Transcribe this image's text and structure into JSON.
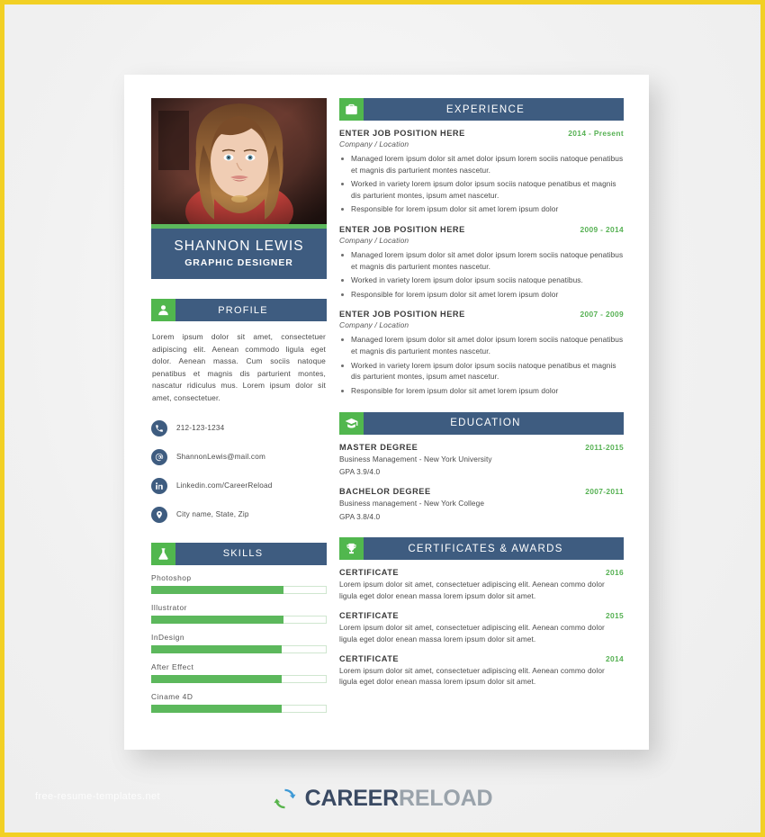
{
  "document": {
    "type": "resume-template-preview"
  },
  "watermark": {
    "text": "free-resume-templates.net"
  },
  "colors": {
    "navy": "#3e5c80",
    "green": "#5cb85c",
    "accent_green_text": "#56b153",
    "border_gold": "#f2d024",
    "body_text": "#4a4a4a"
  },
  "resume": {
    "photo": {
      "alt": "portrait-photo"
    },
    "nameplate": {
      "name": "SHANNON LEWIS",
      "role": "GRAPHIC DESIGNER"
    },
    "profile": {
      "icon": "user-icon",
      "title": "PROFILE",
      "text": "Lorem ipsum dolor sit amet, consectetuer adipiscing elit. Aenean commodo ligula eget dolor. Aenean massa. Cum sociis natoque penatibus et magnis dis parturient montes, nascatur ridiculus mus. Lorem ipsum dolor sit amet, consectetuer."
    },
    "contacts": [
      {
        "icon": "phone-icon",
        "value": "212-123-1234"
      },
      {
        "icon": "email-icon",
        "value": "ShannonLewis@mail.com"
      },
      {
        "icon": "linkedin-icon",
        "value": "Linkedin.com/CareerReload"
      },
      {
        "icon": "location-icon",
        "value": "City name, State, Zip"
      }
    ],
    "skills": {
      "icon": "flask-icon",
      "title": "SKILLS",
      "items": [
        {
          "name": "Photoshop",
          "percent": 75
        },
        {
          "name": "Illustrator",
          "percent": 75
        },
        {
          "name": "InDesign",
          "percent": 74
        },
        {
          "name": "After Effect",
          "percent": 74
        },
        {
          "name": "Ciname 4D",
          "percent": 74
        }
      ]
    },
    "experience": {
      "icon": "briefcase-icon",
      "title": "EXPERIENCE",
      "entries": [
        {
          "position": "ENTER JOB POSITION HERE",
          "date": "2014 - Present",
          "company": "Company / Location",
          "bullets": [
            "Managed lorem ipsum dolor sit amet dolor ipsum lorem sociis natoque penatibus et magnis dis parturient montes nascetur.",
            "Worked in variety lorem ipsum dolor ipsum sociis natoque penatibus et magnis dis parturient montes, ipsum amet nascetur.",
            "Responsible for lorem ipsum dolor sit amet lorem ipsum dolor"
          ]
        },
        {
          "position": "ENTER JOB POSITION HERE",
          "date": "2009 - 2014",
          "company": "Company / Location",
          "bullets": [
            "Managed lorem ipsum dolor sit amet dolor ipsum lorem sociis natoque penatibus et magnis dis parturient montes nascetur.",
            "Worked in variety lorem ipsum dolor ipsum sociis natoque penatibus.",
            "Responsible for lorem ipsum dolor sit amet lorem ipsum dolor"
          ]
        },
        {
          "position": "ENTER JOB POSITION HERE",
          "date": "2007 - 2009",
          "company": "Company / Location",
          "bullets": [
            "Managed lorem ipsum dolor sit amet dolor ipsum lorem sociis natoque penatibus et magnis dis parturient montes nascetur.",
            "Worked in variety lorem ipsum dolor ipsum sociis natoque penatibus et magnis dis parturient montes, ipsum amet nascetur.",
            "Responsible for lorem ipsum dolor sit amet lorem ipsum dolor"
          ]
        }
      ]
    },
    "education": {
      "icon": "graduation-cap-icon",
      "title": "EDUCATION",
      "entries": [
        {
          "degree": "MASTER DEGREE",
          "date": "2011-2015",
          "school": "Business Management - New York University",
          "gpa": "GPA 3.9/4.0"
        },
        {
          "degree": "BACHELOR DEGREE",
          "date": "2007-2011",
          "school": "Business management - New York College",
          "gpa": "GPA 3.8/4.0"
        }
      ]
    },
    "certificates": {
      "icon": "trophy-icon",
      "title": "CERTIFICATES & AWARDS",
      "entries": [
        {
          "name": "CERTIFICATE",
          "date": "2016",
          "description": "Lorem ipsum dolor sit amet, consectetuer adipiscing elit. Aenean commo dolor ligula eget dolor enean massa lorem ipsum dolor sit amet."
        },
        {
          "name": "CERTIFICATE",
          "date": "2015",
          "description": "Lorem ipsum dolor sit amet, consectetuer adipiscing elit. Aenean commo dolor ligula eget dolor enean massa lorem ipsum dolor sit amet."
        },
        {
          "name": "CERTIFICATE",
          "date": "2014",
          "description": "Lorem ipsum dolor sit amet, consectetuer adipiscing elit. Aenean commo dolor ligula eget dolor enean massa lorem ipsum dolor sit amet."
        }
      ]
    }
  },
  "brand": {
    "icon": "refresh-circle-icon",
    "part1": "CAREER",
    "part2": "RELOAD"
  }
}
